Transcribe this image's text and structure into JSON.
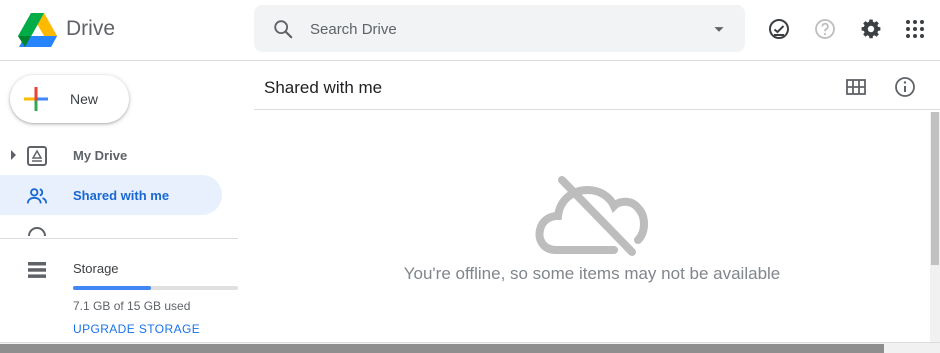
{
  "header": {
    "app_title": "Drive",
    "search_placeholder": "Search Drive",
    "icons": [
      "drive-logo",
      "search-icon",
      "chevron-down-icon",
      "ready-for-offline-icon",
      "help-icon",
      "gear-icon",
      "apps-grid-icon"
    ]
  },
  "sidebar": {
    "new_label": "New",
    "items": [
      {
        "label": "My Drive",
        "icon": "my-drive-icon",
        "active": false
      },
      {
        "label": "Shared with me",
        "icon": "people-icon",
        "active": true
      }
    ],
    "storage": {
      "label": "Storage",
      "used_text": "7.1 GB of 15 GB used",
      "used_fraction": 0.47,
      "upgrade_label": "UPGRADE STORAGE"
    }
  },
  "main": {
    "title": "Shared with me",
    "offline_message": "You're offline, so some items may not be available",
    "icons": [
      "grid-view-icon",
      "info-icon",
      "cloud-off-icon"
    ]
  },
  "colors": {
    "accent_blue": "#1a73e8",
    "active_nav_bg": "#e8f0fe",
    "active_nav_text": "#1967d2",
    "muted_icon": "#5f6368",
    "offline_gray": "#bdbdbd"
  }
}
